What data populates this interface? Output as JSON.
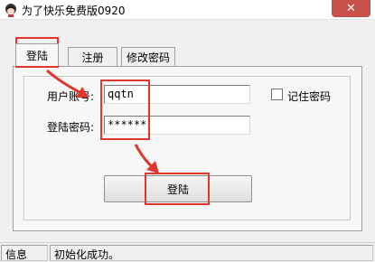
{
  "window": {
    "title": "为了快乐免费版0920"
  },
  "tabs": [
    {
      "label": "登陆",
      "active": true
    },
    {
      "label": "注册",
      "active": false
    },
    {
      "label": "修改密码",
      "active": false
    }
  ],
  "form": {
    "username_label": "用户账号:",
    "username_value": "qqtn",
    "password_label": "登陆密码:",
    "password_value": "******",
    "remember_label": "记住密码",
    "remember_checked": false,
    "login_button": "登陆"
  },
  "statusbar": {
    "label": "信息",
    "message": "初始化成功。"
  },
  "annotation_color": "#e0362c"
}
